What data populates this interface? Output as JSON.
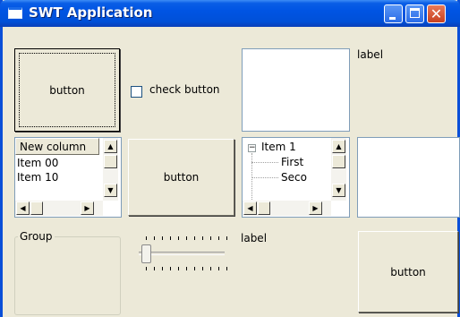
{
  "window": {
    "title": "SWT Application",
    "minimize_glyph": "",
    "maximize_glyph": "",
    "close_glyph": "✕"
  },
  "row1": {
    "button_label": "button",
    "check_label": "check button",
    "check_checked": false,
    "label_text": "label"
  },
  "table": {
    "column_header": "New column",
    "rows": [
      "Item 00",
      "Item 10"
    ]
  },
  "row2": {
    "button_label": "button"
  },
  "tree": {
    "root_label": "Item 1",
    "root_expanded": true,
    "children": [
      "First",
      "Seco"
    ]
  },
  "row3": {
    "group_label": "Group",
    "label_text": "label",
    "button_label": "button",
    "slider_value_fraction": 0.0
  },
  "icons": {
    "up": "▲",
    "down": "▼",
    "left": "◀",
    "right": "▶",
    "expand_minus": "−"
  }
}
